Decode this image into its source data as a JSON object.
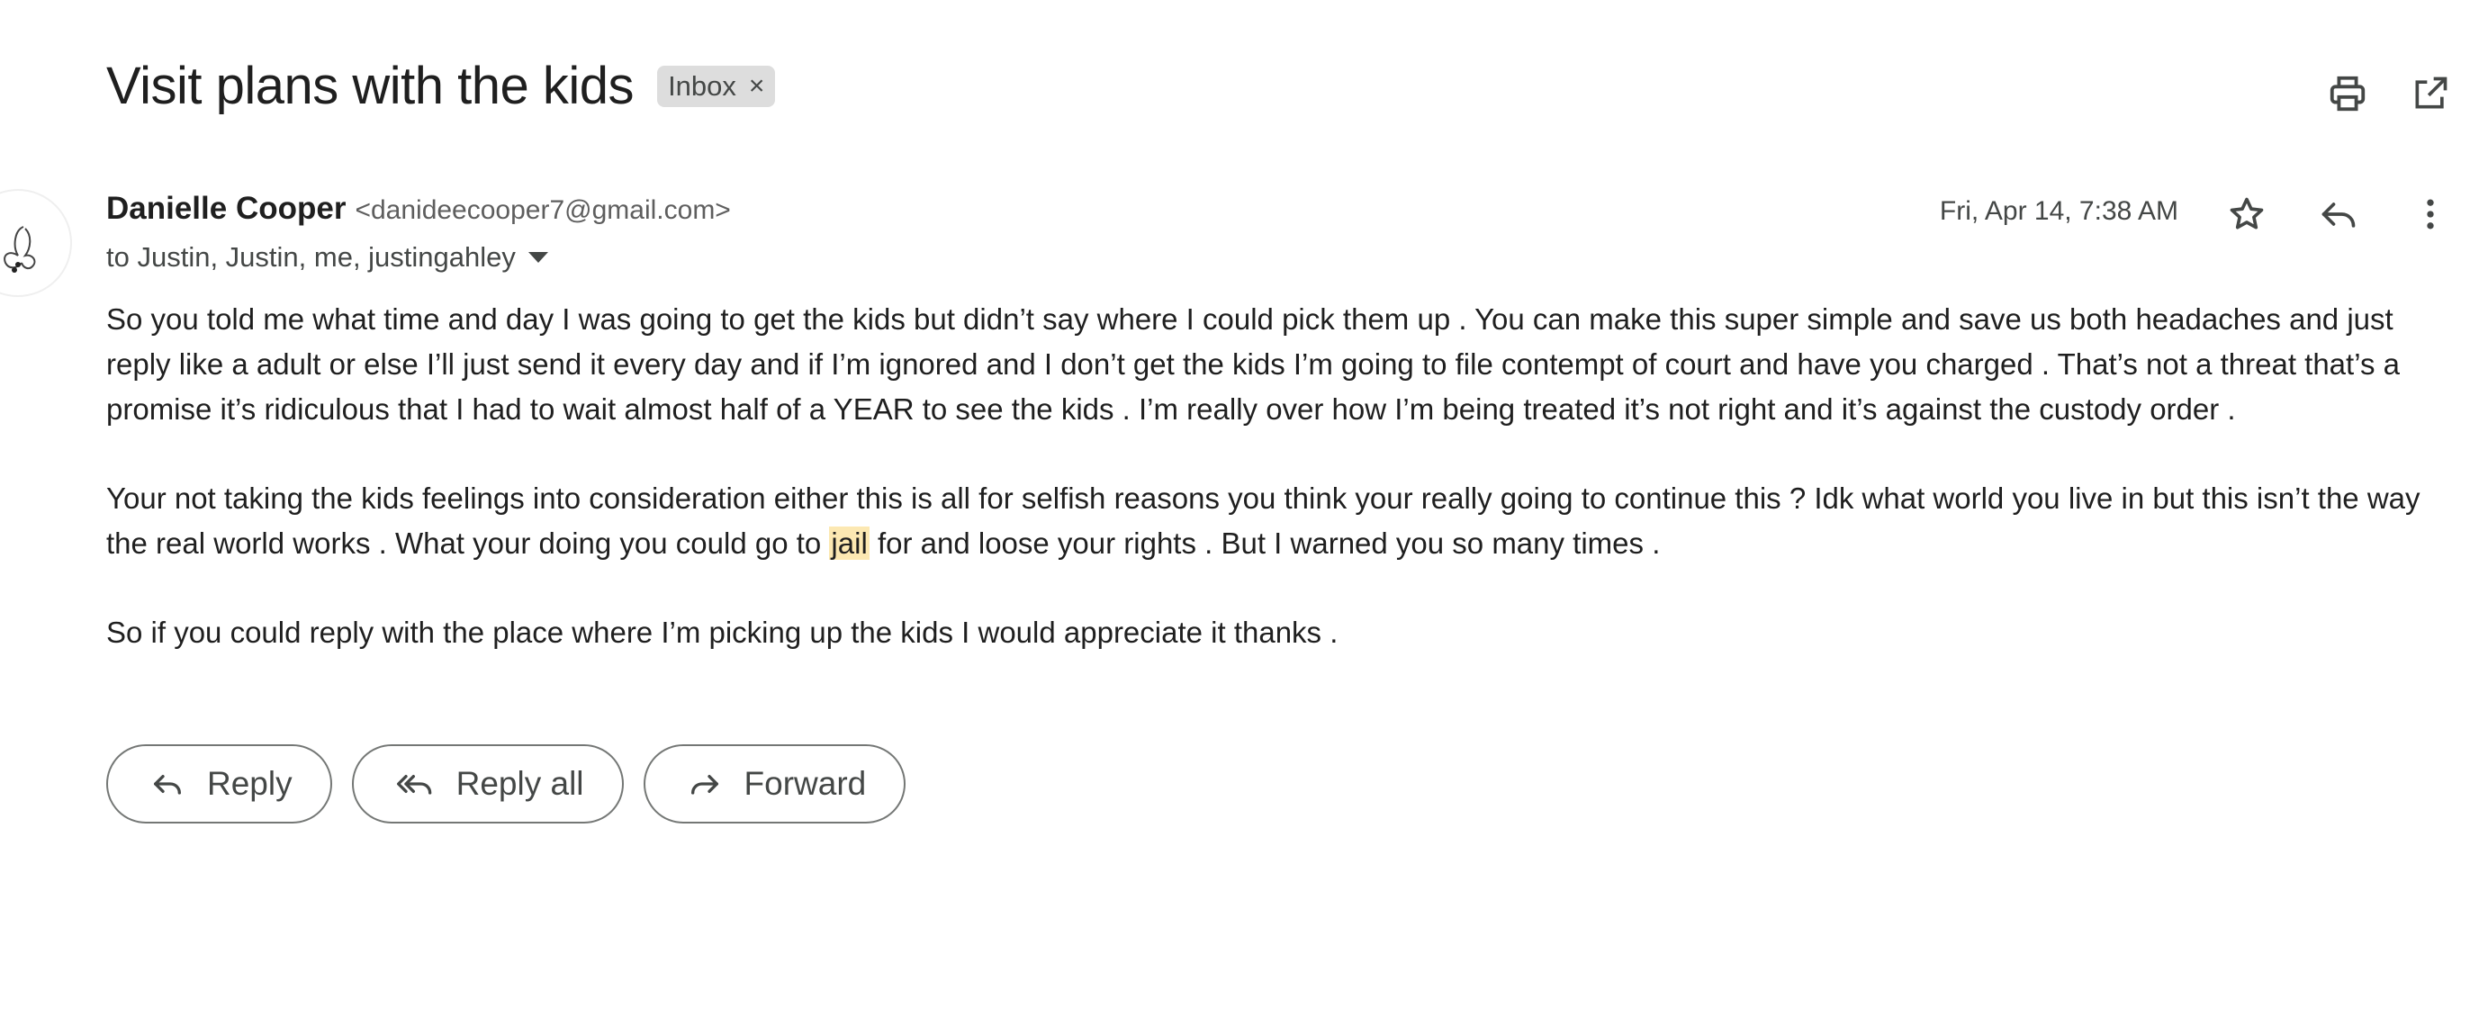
{
  "email": {
    "subject": "Visit plans with the kids",
    "label_chip": "Inbox",
    "label_remove": "×",
    "sender_name": "Danielle Cooper",
    "sender_email": "<danideecooper7@gmail.com>",
    "recipients": "to Justin, Justin, me, justingahley",
    "date": "Fri, Apr 14, 7:38 AM",
    "body": {
      "p1": "So you told me what time and day I was going to get the kids but didn’t say where I could pick them up . You can make this super simple and save us both headaches and just reply like a adult or else I’ll just send it every day and if I’m ignored and I don’t get the kids I’m going to file contempt of court and have you charged . That’s not a threat that’s a promise it’s ridiculous that I had to wait almost half of a YEAR to see the kids . I’m really over how I’m being treated it’s not right and it’s against the custody order .",
      "p2_before": "Your not taking the kids feelings into consideration either this is all for selfish reasons you think your really going to continue this ? Idk what world you live in but this isn’t the way the real world works . What your doing you could go to ",
      "p2_highlight": "jail",
      "p2_after": " for and loose your rights . But I warned you so many times .",
      "p3": "So if you could reply with the place where I’m picking up the kids I would appreciate it thanks ."
    }
  },
  "actions": {
    "reply": "Reply",
    "reply_all": "Reply all",
    "forward": "Forward"
  },
  "icons": {
    "print": "print-icon",
    "open_new_window": "open-in-new-icon",
    "star": "star-icon",
    "reply": "reply-icon",
    "more": "more-vert-icon",
    "avatar": "butterfly-avatar"
  }
}
